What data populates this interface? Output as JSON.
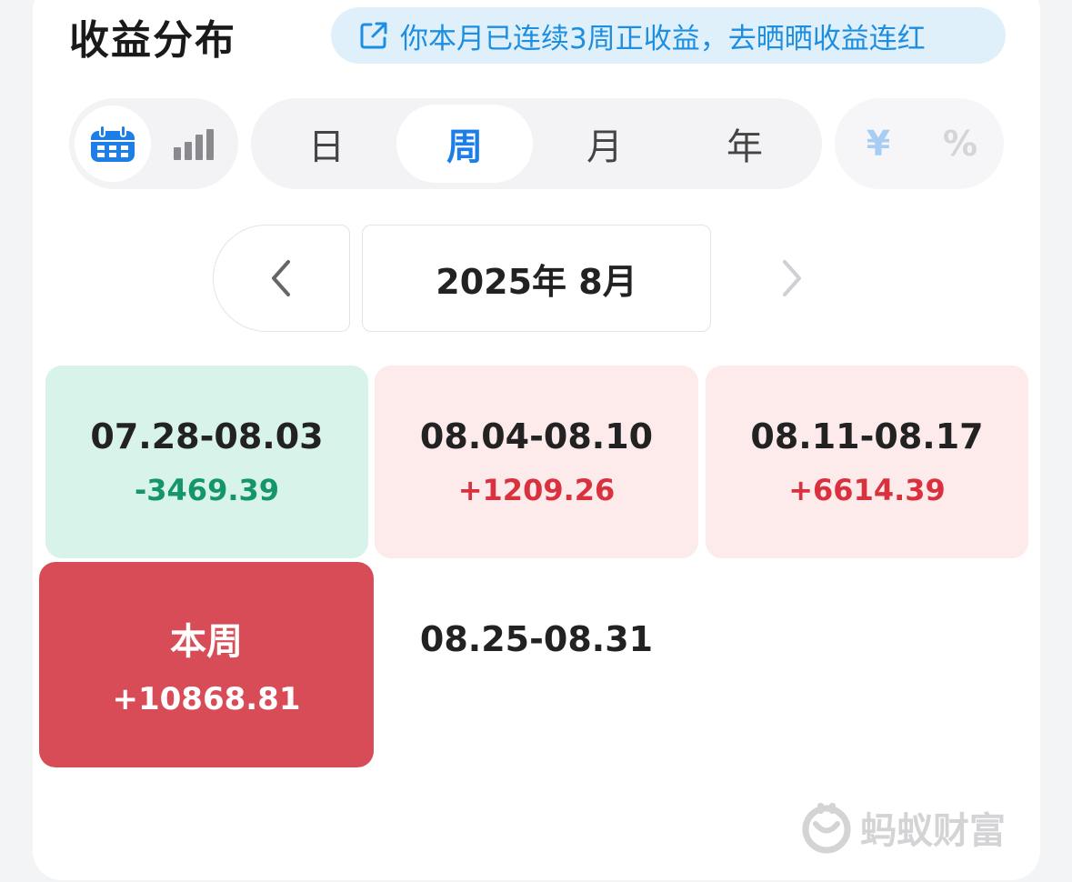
{
  "header": {
    "title": "收益分布",
    "banner_text": "你本月已连续3周正收益，去晒晒收益连红"
  },
  "view_toggle": {
    "options": [
      {
        "icon": "calendar-icon",
        "selected": true
      },
      {
        "icon": "bar-chart-icon",
        "selected": false
      }
    ]
  },
  "period_tabs": [
    {
      "label": "日",
      "selected": false
    },
    {
      "label": "周",
      "selected": true
    },
    {
      "label": "月",
      "selected": false
    },
    {
      "label": "年",
      "selected": false
    }
  ],
  "unit_toggle": {
    "yen": "¥",
    "percent": "%"
  },
  "month_nav": {
    "label": "2025年 8月",
    "prev_icon": "chevron-left-icon",
    "next_icon": "chevron-right-icon"
  },
  "weeks": [
    {
      "range": "07.28-08.03",
      "value": "-3469.39"
    },
    {
      "range": "08.04-08.10",
      "value": "+1209.26"
    },
    {
      "range": "08.11-08.17",
      "value": "+6614.39"
    },
    {
      "range": "本周",
      "value": "+10868.81"
    },
    {
      "range": "08.25-08.31",
      "value": ""
    }
  ],
  "brand": {
    "name": "蚂蚁财富"
  },
  "colors": {
    "accent_blue": "#1d7ee8",
    "gain_red": "#d9313e",
    "loss_green": "#14966a",
    "current_week_bg": "#d84c57"
  }
}
